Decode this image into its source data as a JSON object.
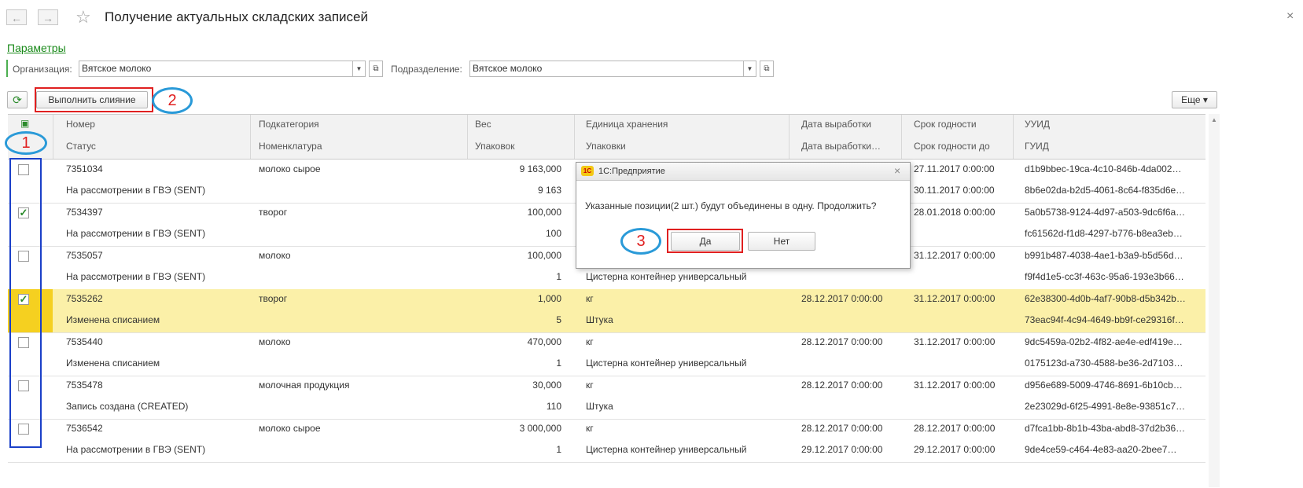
{
  "window": {
    "title": "Получение актуальных складских записей",
    "nav_back": "←",
    "nav_forward": "→",
    "star": "☆",
    "close": "×"
  },
  "params": {
    "link": "Параметры",
    "org_label": "Организация:",
    "org_value": "Вятское молоко",
    "dept_label": "Подразделение:",
    "dept_value": "Вятское молоко"
  },
  "toolbar": {
    "refresh": "⟳",
    "merge": "Выполнить слияние",
    "more": "Еще ▾"
  },
  "table": {
    "headers_top": [
      "Номер",
      "Подкатегория",
      "Вес",
      "Единица хранения",
      "Дата выработки",
      "Срок годности",
      "УУИД"
    ],
    "headers_bottom": [
      "Статус",
      "Номенклатура",
      "Упаковок",
      "Упаковки",
      "Дата выработки…",
      "Срок годности до",
      "ГУИД"
    ],
    "rows": [
      {
        "checked": false,
        "number": "7351034",
        "subcat": "молоко сырое",
        "weight": "9 163,000",
        "unit": "",
        "date": "",
        "expiry": "27.11.2017 0:00:00",
        "uuid": "d1b9bbec-19ca-4c10-846b-4da002…",
        "status": "На рассмотрении в ГВЭ (SENT)",
        "nomen": "",
        "packs": "9 163",
        "pack": "",
        "date2": "",
        "expiry2": "30.11.2017 0:00:00",
        "guid": "8b6e02da-b2d5-4061-8c64-f835d6e…"
      },
      {
        "checked": true,
        "number": "7534397",
        "subcat": "творог",
        "weight": "100,000",
        "unit": "",
        "date": "",
        "expiry": "28.01.2018 0:00:00",
        "uuid": "5a0b5738-9124-4d97-a503-9dc6f6a…",
        "status": "На рассмотрении в ГВЭ (SENT)",
        "nomen": "",
        "packs": "100",
        "pack": "",
        "date2": "",
        "expiry2": "",
        "guid": "fc61562d-f1d8-4297-b776-b8ea3eb…"
      },
      {
        "checked": false,
        "number": "7535057",
        "subcat": "молоко",
        "weight": "100,000",
        "unit": "",
        "date": "",
        "expiry": "31.12.2017 0:00:00",
        "uuid": "b991b487-4038-4ae1-b3a9-b5d56d…",
        "status": "На рассмотрении в ГВЭ (SENT)",
        "nomen": "",
        "packs": "1",
        "pack": "Цистерна контейнер универсальный",
        "date2": "",
        "expiry2": "",
        "guid": "f9f4d1e5-cc3f-463c-95a6-193e3b66…"
      },
      {
        "checked": true,
        "selected": true,
        "number": "7535262",
        "subcat": "творог",
        "weight": "1,000",
        "unit": "кг",
        "date": "28.12.2017 0:00:00",
        "expiry": "31.12.2017 0:00:00",
        "uuid": "62e38300-4d0b-4af7-90b8-d5b342b…",
        "status": "Изменена списанием",
        "nomen": "",
        "packs": "5",
        "pack": "Штука",
        "date2": "",
        "expiry2": "",
        "guid": "73eac94f-4c94-4649-bb9f-ce29316f…"
      },
      {
        "checked": false,
        "number": "7535440",
        "subcat": "молоко",
        "weight": "470,000",
        "unit": "кг",
        "date": "28.12.2017 0:00:00",
        "expiry": "31.12.2017 0:00:00",
        "uuid": "9dc5459a-02b2-4f82-ae4e-edf419e…",
        "status": "Изменена списанием",
        "nomen": "",
        "packs": "1",
        "pack": "Цистерна контейнер универсальный",
        "date2": "",
        "expiry2": "",
        "guid": "0175123d-a730-4588-be36-2d7103…"
      },
      {
        "checked": false,
        "number": "7535478",
        "subcat": "молочная продукция",
        "weight": "30,000",
        "unit": "кг",
        "date": "28.12.2017 0:00:00",
        "expiry": "31.12.2017 0:00:00",
        "uuid": "d956e689-5009-4746-8691-6b10cb…",
        "status": "Запись создана (CREATED)",
        "nomen": "",
        "packs": "110",
        "pack": "Штука",
        "date2": "",
        "expiry2": "",
        "guid": "2e23029d-6f25-4991-8e8e-93851c7…"
      },
      {
        "checked": false,
        "number": "7536542",
        "subcat": "молоко сырое",
        "weight": "3 000,000",
        "unit": "кг",
        "date": "28.12.2017 0:00:00",
        "expiry": "28.12.2017 0:00:00",
        "uuid": "d7fca1bb-8b1b-43ba-abd8-37d2b36…",
        "status": "На рассмотрении в ГВЭ (SENT)",
        "nomen": "",
        "packs": "1",
        "pack": "Цистерна контейнер универсальный",
        "date2": "29.12.2017 0:00:00",
        "expiry2": "29.12.2017 0:00:00",
        "guid": "9de4ce59-c464-4e83-aa20-2bee7…"
      }
    ]
  },
  "dialog": {
    "icon": "1С",
    "title": "1С:Предприятие",
    "close": "×",
    "message": "Указанные позиции(2 шт.) будут объединены в одну. Продолжить?",
    "yes": "Да",
    "no": "Нет"
  },
  "annotations": {
    "step1": "1",
    "step2": "2",
    "step3": "3"
  }
}
